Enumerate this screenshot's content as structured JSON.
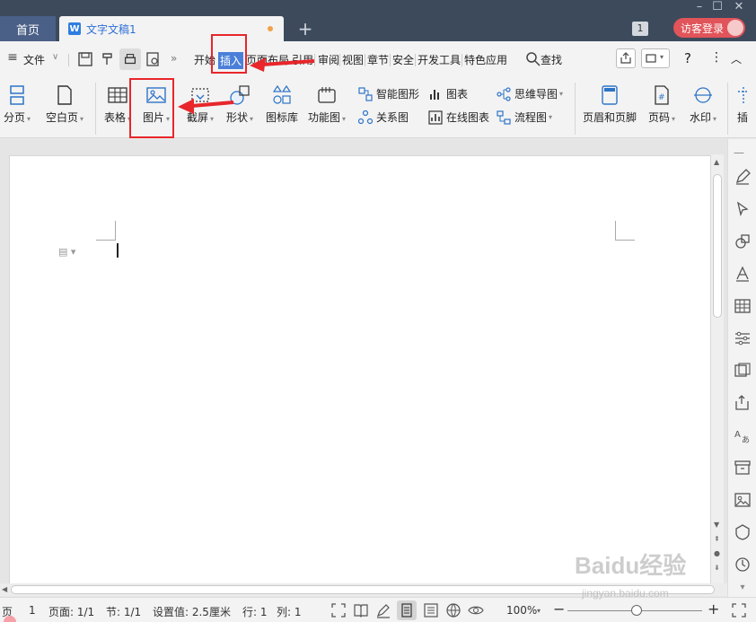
{
  "titlebar": {
    "home_tab": "首页",
    "doc_tab": "文字文稿1",
    "doc_icon_letter": "W",
    "new_tab": "+",
    "count_badge": "1",
    "login_label": "访客登录"
  },
  "menubar": {
    "file": "文件",
    "more": "»",
    "items": [
      "开始",
      "插入",
      "页面布局",
      "引用",
      "审阅",
      "视图",
      "章节",
      "安全",
      "开发工具",
      "特色应用"
    ],
    "search": "查找",
    "help": "?",
    "dots": "⋮"
  },
  "ribbon": {
    "page_break": "分页",
    "blank_page": "空白页",
    "table": "表格",
    "picture": "图片",
    "screenshot": "截屏",
    "shape": "形状",
    "icon_lib": "图标库",
    "func_chart": "功能图",
    "smart_art": "智能图形",
    "chart": "图表",
    "mind_map": "思维导图",
    "relation": "关系图",
    "online_chart": "在线图表",
    "flowchart": "流程图",
    "header_footer": "页眉和页脚",
    "page_num": "页码",
    "watermark": "水印",
    "cut": "插"
  },
  "status": {
    "page_label": "页",
    "page_no": "1",
    "pages": "页面: 1/1",
    "section": "节: 1/1",
    "setting": "设置值: 2.5厘米",
    "row": "行: 1",
    "col": "列: 1",
    "zoom": "100%"
  },
  "watermark": {
    "brand": "Baidu经验",
    "url": "jingyan.baidu.com"
  },
  "colors": {
    "titlebar": "#3c4a5c",
    "accent": "#4a7fd9",
    "annotation": "#e8262b",
    "login": "#e0545a"
  }
}
